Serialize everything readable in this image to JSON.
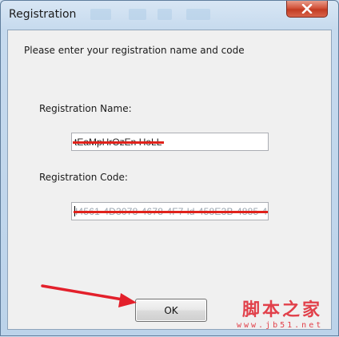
{
  "window": {
    "title": "Registration",
    "close_icon": "close-icon"
  },
  "dialog": {
    "prompt": "Please enter your registration name and code",
    "name_label": "Registration Name:",
    "name_value": "tEaMpHrOzEn HoLL",
    "code_label": "Registration Code:",
    "code_value": "I4561-4D3078-4678-4F7-ld-458E3B-4885-4C4C",
    "ok_label": "OK"
  },
  "watermark": {
    "brand": "脚本之家",
    "site": "www.jb51.net"
  },
  "colors": {
    "redaction": "#e0221b",
    "arrow": "#e3202b",
    "watermark": "#e1404a"
  }
}
